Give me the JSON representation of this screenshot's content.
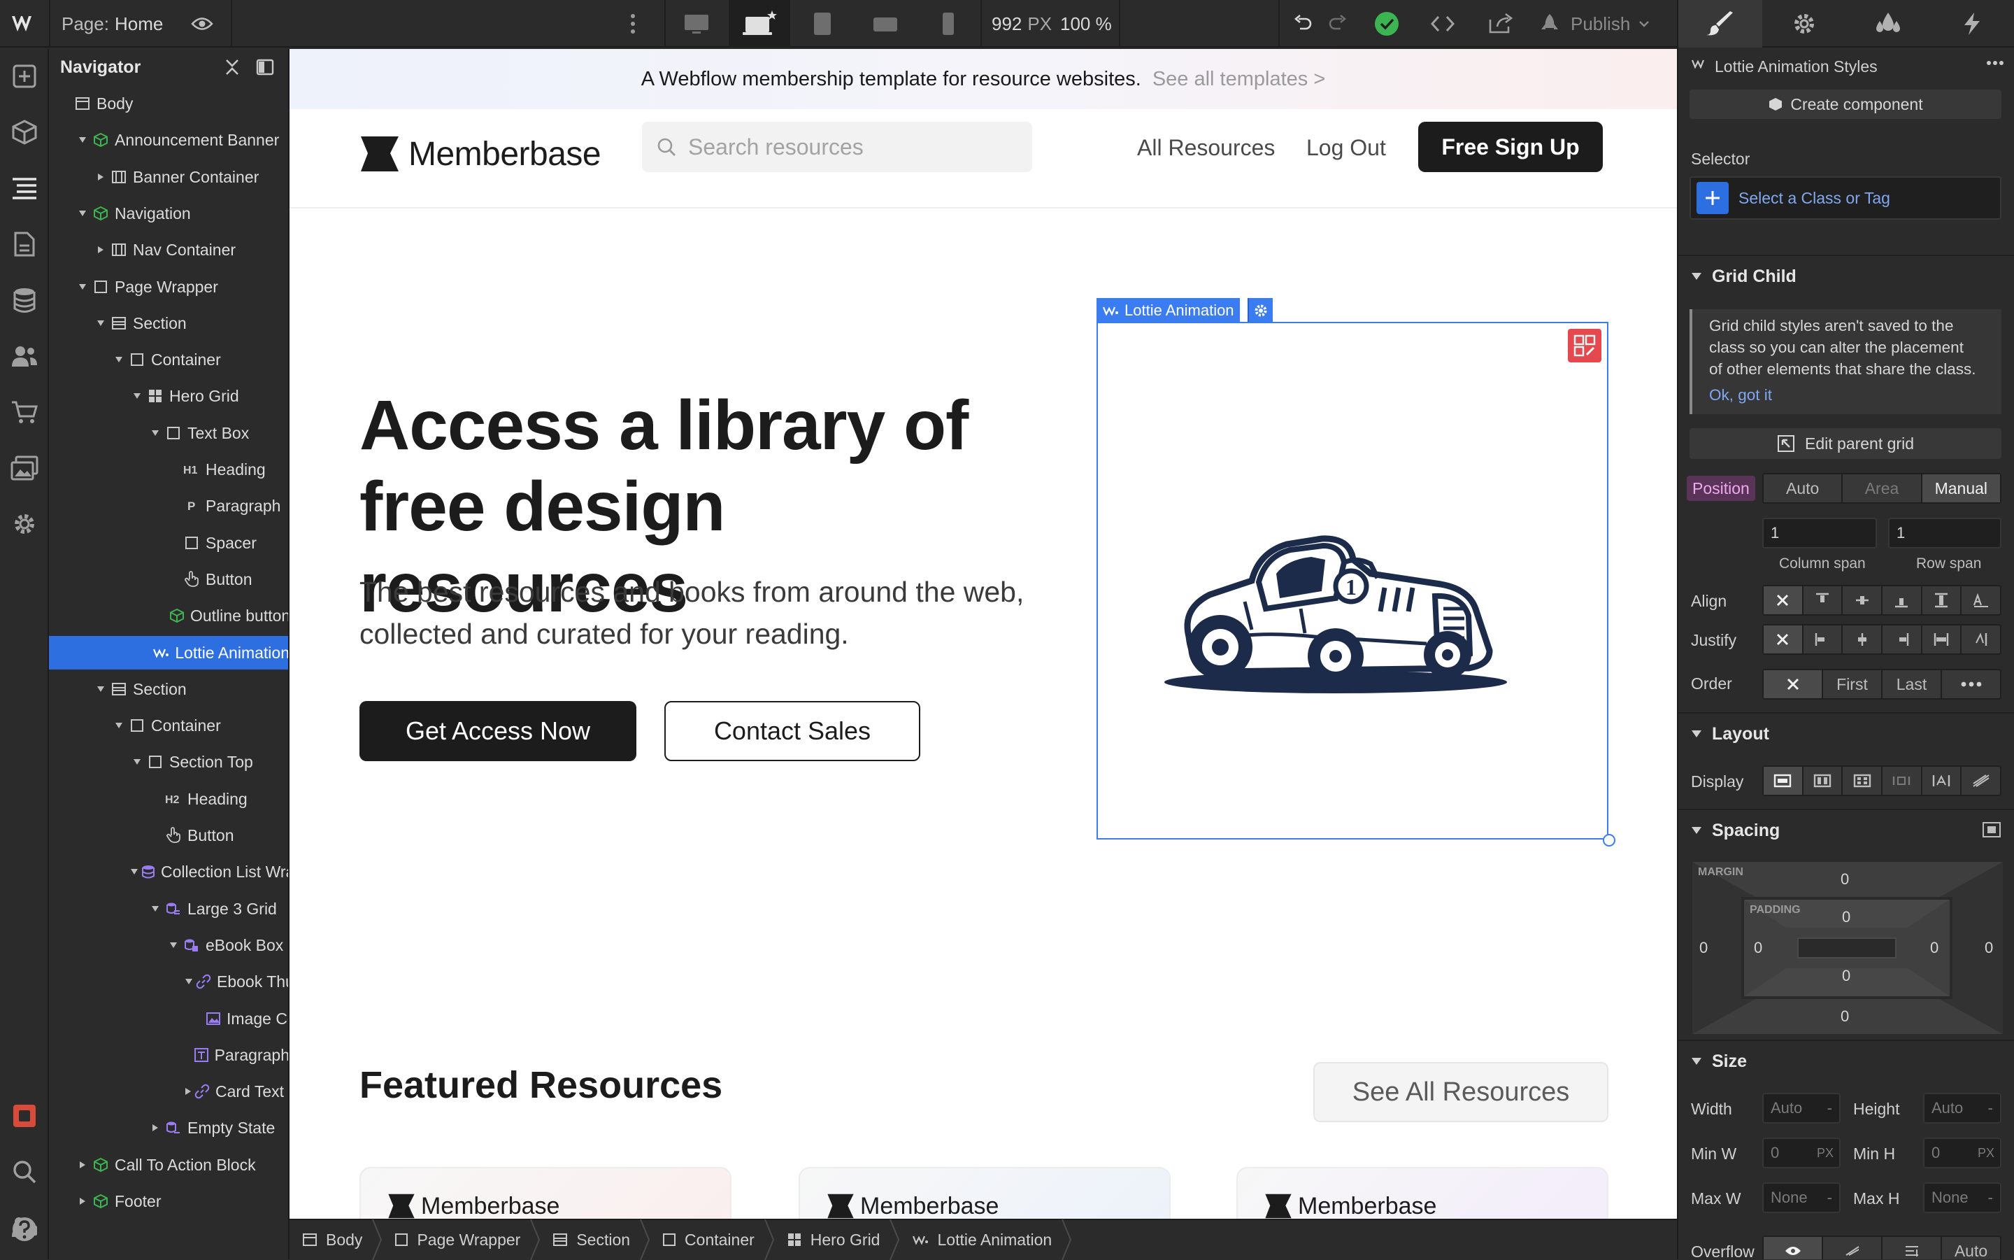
{
  "topbar": {
    "page_prefix": "Page:",
    "page_name": "Home",
    "width_value": "992",
    "width_unit": "PX",
    "zoom": "100 %",
    "publish_label": "Publish"
  },
  "navigator": {
    "title": "Navigator",
    "tree": [
      {
        "label": "Body",
        "icon": "body-icon",
        "level": 0,
        "caret": "none"
      },
      {
        "label": "Announcement Banner",
        "icon": "symbol-icon",
        "level": 1,
        "caret": "open"
      },
      {
        "label": "Banner Container",
        "icon": "container-icon",
        "level": 2,
        "caret": "closed"
      },
      {
        "label": "Navigation",
        "icon": "symbol-icon",
        "level": 1,
        "caret": "open"
      },
      {
        "label": "Nav Container",
        "icon": "container-icon",
        "level": 2,
        "caret": "closed"
      },
      {
        "label": "Page Wrapper",
        "icon": "div-icon",
        "level": 1,
        "caret": "open"
      },
      {
        "label": "Section",
        "icon": "section-icon",
        "level": 2,
        "caret": "open"
      },
      {
        "label": "Container",
        "icon": "div-icon",
        "level": 3,
        "caret": "open"
      },
      {
        "label": "Hero Grid",
        "icon": "grid-icon",
        "level": 4,
        "caret": "open"
      },
      {
        "label": "Text Box",
        "icon": "div-icon",
        "level": 5,
        "caret": "open"
      },
      {
        "label": "Heading",
        "icon": "h1-icon",
        "level": 6,
        "caret": "none"
      },
      {
        "label": "Paragraph",
        "icon": "paragraph-icon",
        "level": 6,
        "caret": "none"
      },
      {
        "label": "Spacer",
        "icon": "div-icon",
        "level": 6,
        "caret": "none"
      },
      {
        "label": "Button",
        "icon": "hand-icon",
        "level": 6,
        "caret": "none"
      },
      {
        "label": "Outline button",
        "icon": "symbol-icon",
        "level": 6,
        "caret": "none"
      },
      {
        "label": "Lottie Animation",
        "icon": "lottie-icon",
        "level": 5,
        "caret": "none",
        "selected": true
      },
      {
        "label": "Section",
        "icon": "section-icon",
        "level": 2,
        "caret": "open"
      },
      {
        "label": "Container",
        "icon": "div-icon",
        "level": 3,
        "caret": "open"
      },
      {
        "label": "Section Top",
        "icon": "div-icon",
        "level": 4,
        "caret": "open"
      },
      {
        "label": "Heading",
        "icon": "h2-icon",
        "level": 5,
        "caret": "none"
      },
      {
        "label": "Button",
        "icon": "hand-icon",
        "level": 5,
        "caret": "none"
      },
      {
        "label": "Collection List Wrap",
        "icon": "collection-icon",
        "level": 4,
        "caret": "open"
      },
      {
        "label": "Large 3 Grid",
        "icon": "collection-list-icon",
        "level": 5,
        "caret": "open"
      },
      {
        "label": "eBook Box",
        "icon": "collection-item-icon",
        "level": 6,
        "caret": "open"
      },
      {
        "label": "Ebook Thu...",
        "icon": "link-icon",
        "level": 7,
        "caret": "open"
      },
      {
        "label": "Image Co...",
        "icon": "image-icon",
        "level": 8,
        "caret": "none"
      },
      {
        "label": "Paragraph",
        "icon": "text-field-icon",
        "level": 7,
        "caret": "none"
      },
      {
        "label": "Card Text Li",
        "icon": "link-icon",
        "level": 7,
        "caret": "closed"
      },
      {
        "label": "Empty State",
        "icon": "empty-state-icon",
        "level": 5,
        "caret": "closed"
      },
      {
        "label": "Call To Action Block",
        "icon": "symbol-icon",
        "level": 1,
        "caret": "closed"
      },
      {
        "label": "Footer",
        "icon": "symbol-icon",
        "level": 1,
        "caret": "closed"
      }
    ]
  },
  "site": {
    "announcement_text": "A Webflow membership template for resource websites.",
    "announcement_link": "See all templates >",
    "brand": "Memberbase",
    "search_placeholder": "Search resources",
    "nav_links": [
      "All Resources",
      "Log Out"
    ],
    "signup_button": "Free Sign Up",
    "hero_heading_line1": "Access a library of",
    "hero_heading_line2": "free design resources",
    "hero_paragraph_line1": "The best resources and books from around the web,",
    "hero_paragraph_line2": "collected and curated for your reading.",
    "primary_cta": "Get Access Now",
    "secondary_cta": "Contact Sales",
    "lottie_badge": "Lottie Animation",
    "car_number": "1",
    "featured_heading": "Featured Resources",
    "see_all_button": "See All Resources",
    "cards": [
      {
        "brand": "Memberbase",
        "tint": "#fbeeee"
      },
      {
        "brand": "Memberbase",
        "tint": "#ecf2fb"
      },
      {
        "brand": "Memberbase",
        "tint": "#f3ecfb"
      }
    ]
  },
  "breadcrumbs": [
    {
      "label": "Body",
      "icon": "body-icon"
    },
    {
      "label": "Page Wrapper",
      "icon": "div-icon"
    },
    {
      "label": "Section",
      "icon": "section-icon"
    },
    {
      "label": "Container",
      "icon": "div-icon"
    },
    {
      "label": "Hero Grid",
      "icon": "grid-icon"
    },
    {
      "label": "Lottie Animation",
      "icon": "lottie-icon"
    }
  ],
  "style_panel": {
    "element_title": "Lottie Animation Styles",
    "create_component": "Create component",
    "selector_label": "Selector",
    "selector_placeholder": "Select a Class or Tag",
    "grid_child": {
      "title": "Grid Child",
      "info_line1": "Grid child styles aren't saved to the",
      "info_line2": "class so you can alter the placement",
      "info_line3": "of other elements that share the class.",
      "info_link": "Ok, got it",
      "edit_parent": "Edit parent grid",
      "position_label": "Position",
      "position_options": [
        "Auto",
        "Area",
        "Manual"
      ],
      "position_selected": "Manual",
      "column_span_value": "1",
      "row_span_value": "1",
      "column_span_label": "Column span",
      "row_span_label": "Row span",
      "align_label": "Align",
      "justify_label": "Justify",
      "order_label": "Order",
      "order_options": [
        "First",
        "Last"
      ]
    },
    "layout": {
      "title": "Layout",
      "display_label": "Display"
    },
    "spacing": {
      "title": "Spacing",
      "margin_label": "MARGIN",
      "padding_label": "PADDING",
      "margin_top": "0",
      "margin_right": "0",
      "margin_bottom": "0",
      "margin_left": "0",
      "padding_top": "0",
      "padding_right": "0",
      "padding_bottom": "0",
      "padding_left": "0"
    },
    "size": {
      "title": "Size",
      "width_label": "Width",
      "width_value": "Auto",
      "height_label": "Height",
      "height_value": "Auto",
      "minw_label": "Min W",
      "minw_value": "0",
      "minw_unit": "PX",
      "minh_label": "Min H",
      "minh_value": "0",
      "minh_unit": "PX",
      "maxw_label": "Max W",
      "maxw_value": "None",
      "maxh_label": "Max H",
      "maxh_value": "None",
      "overflow_label": "Overflow",
      "overflow_auto": "Auto"
    }
  },
  "colors": {
    "accent": "#2d6ee0",
    "success": "#3cb451",
    "lottie_outline": "#3b7cf0",
    "grid_icon_red": "#e5484d",
    "symbol_green": "#3cb451",
    "collection_purple": "#9a7cf5",
    "position_pink": "#e66bd1"
  }
}
